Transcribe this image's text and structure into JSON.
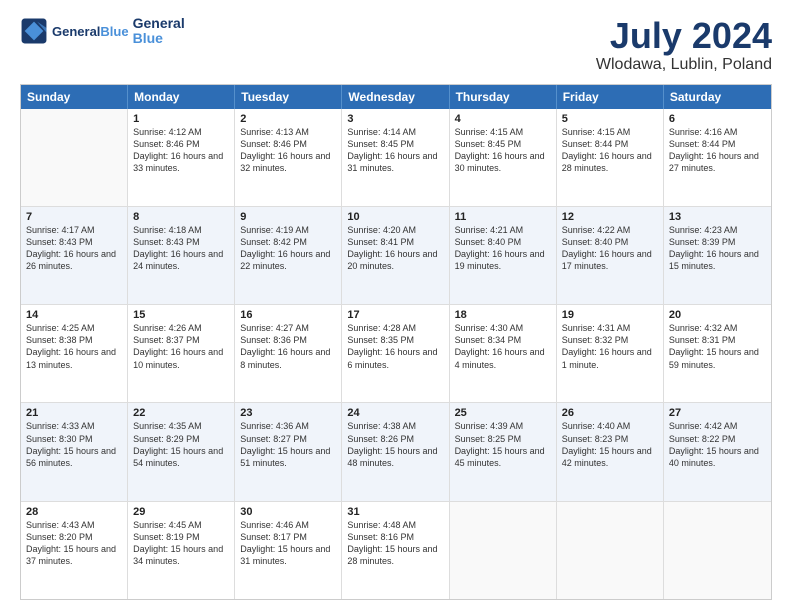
{
  "logo": {
    "line1": "General",
    "line2": "Blue"
  },
  "title": "July 2024",
  "subtitle": "Wlodawa, Lublin, Poland",
  "weekdays": [
    "Sunday",
    "Monday",
    "Tuesday",
    "Wednesday",
    "Thursday",
    "Friday",
    "Saturday"
  ],
  "weeks": [
    [
      {
        "day": "",
        "info": ""
      },
      {
        "day": "1",
        "info": "Sunrise: 4:12 AM\nSunset: 8:46 PM\nDaylight: 16 hours\nand 33 minutes."
      },
      {
        "day": "2",
        "info": "Sunrise: 4:13 AM\nSunset: 8:46 PM\nDaylight: 16 hours\nand 32 minutes."
      },
      {
        "day": "3",
        "info": "Sunrise: 4:14 AM\nSunset: 8:45 PM\nDaylight: 16 hours\nand 31 minutes."
      },
      {
        "day": "4",
        "info": "Sunrise: 4:15 AM\nSunset: 8:45 PM\nDaylight: 16 hours\nand 30 minutes."
      },
      {
        "day": "5",
        "info": "Sunrise: 4:15 AM\nSunset: 8:44 PM\nDaylight: 16 hours\nand 28 minutes."
      },
      {
        "day": "6",
        "info": "Sunrise: 4:16 AM\nSunset: 8:44 PM\nDaylight: 16 hours\nand 27 minutes."
      }
    ],
    [
      {
        "day": "7",
        "info": "Sunrise: 4:17 AM\nSunset: 8:43 PM\nDaylight: 16 hours\nand 26 minutes."
      },
      {
        "day": "8",
        "info": "Sunrise: 4:18 AM\nSunset: 8:43 PM\nDaylight: 16 hours\nand 24 minutes."
      },
      {
        "day": "9",
        "info": "Sunrise: 4:19 AM\nSunset: 8:42 PM\nDaylight: 16 hours\nand 22 minutes."
      },
      {
        "day": "10",
        "info": "Sunrise: 4:20 AM\nSunset: 8:41 PM\nDaylight: 16 hours\nand 20 minutes."
      },
      {
        "day": "11",
        "info": "Sunrise: 4:21 AM\nSunset: 8:40 PM\nDaylight: 16 hours\nand 19 minutes."
      },
      {
        "day": "12",
        "info": "Sunrise: 4:22 AM\nSunset: 8:40 PM\nDaylight: 16 hours\nand 17 minutes."
      },
      {
        "day": "13",
        "info": "Sunrise: 4:23 AM\nSunset: 8:39 PM\nDaylight: 16 hours\nand 15 minutes."
      }
    ],
    [
      {
        "day": "14",
        "info": "Sunrise: 4:25 AM\nSunset: 8:38 PM\nDaylight: 16 hours\nand 13 minutes."
      },
      {
        "day": "15",
        "info": "Sunrise: 4:26 AM\nSunset: 8:37 PM\nDaylight: 16 hours\nand 10 minutes."
      },
      {
        "day": "16",
        "info": "Sunrise: 4:27 AM\nSunset: 8:36 PM\nDaylight: 16 hours\nand 8 minutes."
      },
      {
        "day": "17",
        "info": "Sunrise: 4:28 AM\nSunset: 8:35 PM\nDaylight: 16 hours\nand 6 minutes."
      },
      {
        "day": "18",
        "info": "Sunrise: 4:30 AM\nSunset: 8:34 PM\nDaylight: 16 hours\nand 4 minutes."
      },
      {
        "day": "19",
        "info": "Sunrise: 4:31 AM\nSunset: 8:32 PM\nDaylight: 16 hours\nand 1 minute."
      },
      {
        "day": "20",
        "info": "Sunrise: 4:32 AM\nSunset: 8:31 PM\nDaylight: 15 hours\nand 59 minutes."
      }
    ],
    [
      {
        "day": "21",
        "info": "Sunrise: 4:33 AM\nSunset: 8:30 PM\nDaylight: 15 hours\nand 56 minutes."
      },
      {
        "day": "22",
        "info": "Sunrise: 4:35 AM\nSunset: 8:29 PM\nDaylight: 15 hours\nand 54 minutes."
      },
      {
        "day": "23",
        "info": "Sunrise: 4:36 AM\nSunset: 8:27 PM\nDaylight: 15 hours\nand 51 minutes."
      },
      {
        "day": "24",
        "info": "Sunrise: 4:38 AM\nSunset: 8:26 PM\nDaylight: 15 hours\nand 48 minutes."
      },
      {
        "day": "25",
        "info": "Sunrise: 4:39 AM\nSunset: 8:25 PM\nDaylight: 15 hours\nand 45 minutes."
      },
      {
        "day": "26",
        "info": "Sunrise: 4:40 AM\nSunset: 8:23 PM\nDaylight: 15 hours\nand 42 minutes."
      },
      {
        "day": "27",
        "info": "Sunrise: 4:42 AM\nSunset: 8:22 PM\nDaylight: 15 hours\nand 40 minutes."
      }
    ],
    [
      {
        "day": "28",
        "info": "Sunrise: 4:43 AM\nSunset: 8:20 PM\nDaylight: 15 hours\nand 37 minutes."
      },
      {
        "day": "29",
        "info": "Sunrise: 4:45 AM\nSunset: 8:19 PM\nDaylight: 15 hours\nand 34 minutes."
      },
      {
        "day": "30",
        "info": "Sunrise: 4:46 AM\nSunset: 8:17 PM\nDaylight: 15 hours\nand 31 minutes."
      },
      {
        "day": "31",
        "info": "Sunrise: 4:48 AM\nSunset: 8:16 PM\nDaylight: 15 hours\nand 28 minutes."
      },
      {
        "day": "",
        "info": ""
      },
      {
        "day": "",
        "info": ""
      },
      {
        "day": "",
        "info": ""
      }
    ]
  ]
}
